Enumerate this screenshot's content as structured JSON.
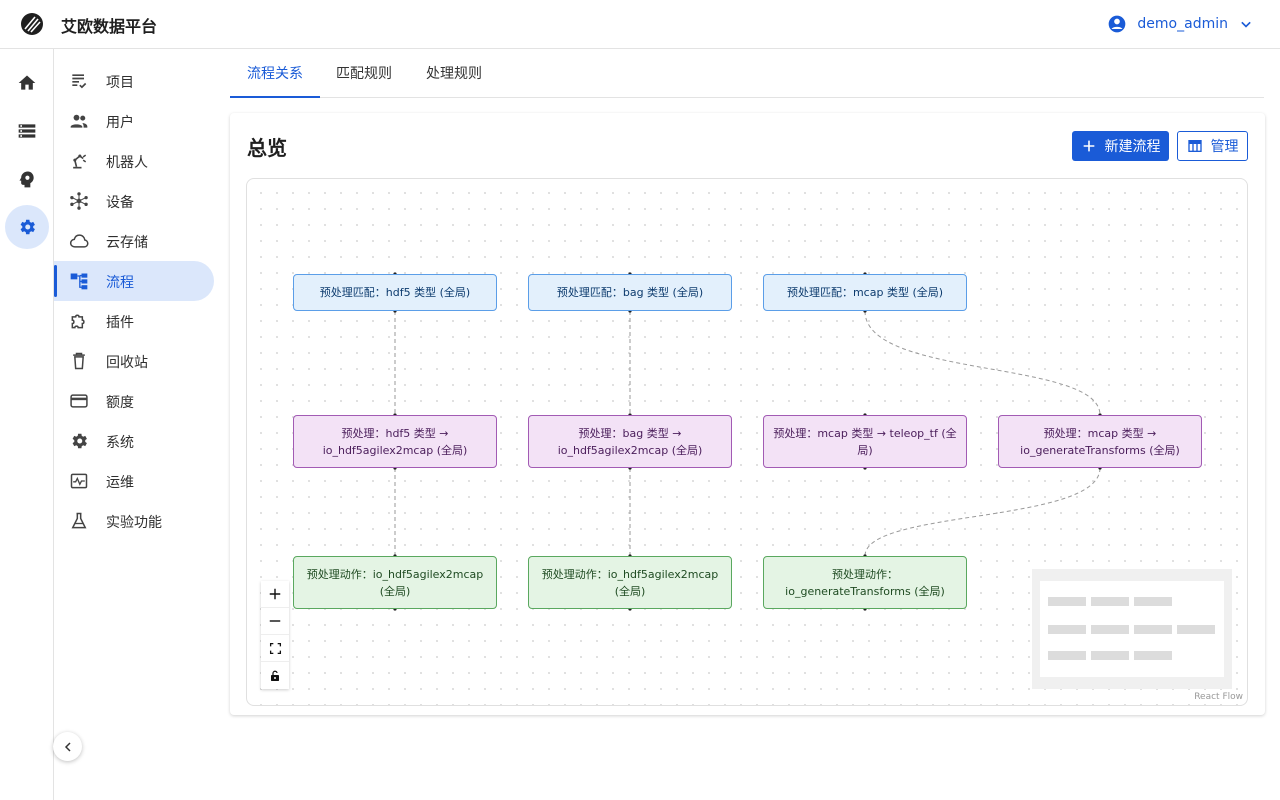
{
  "header": {
    "app_title": "艾欧数据平台",
    "user_name": "demo_admin",
    "icons": [
      "logo-icon",
      "account-circle-icon",
      "chevron-down-icon"
    ]
  },
  "rail": {
    "items": [
      {
        "icon": "home-icon",
        "active": false
      },
      {
        "icon": "storage-icon",
        "active": false
      },
      {
        "icon": "psychology-icon",
        "active": false
      },
      {
        "icon": "gear-icon",
        "active": true
      }
    ],
    "collapse_icon": "chevron-left-icon"
  },
  "subnav": {
    "items": [
      {
        "label": "项目",
        "icon": "checklist-icon"
      },
      {
        "label": "用户",
        "icon": "people-icon"
      },
      {
        "label": "机器人",
        "icon": "robot-arm-icon"
      },
      {
        "label": "设备",
        "icon": "hub-icon"
      },
      {
        "label": "云存储",
        "icon": "cloud-icon"
      },
      {
        "label": "流程",
        "icon": "flow-tree-icon",
        "active": true
      },
      {
        "label": "插件",
        "icon": "puzzle-icon"
      },
      {
        "label": "回收站",
        "icon": "trash-icon"
      },
      {
        "label": "额度",
        "icon": "credit-card-icon"
      },
      {
        "label": "系统",
        "icon": "gear-icon"
      },
      {
        "label": "运维",
        "icon": "monitor-icon"
      },
      {
        "label": "实验功能",
        "icon": "flask-icon"
      }
    ]
  },
  "tabs": [
    {
      "label": "流程关系",
      "active": true
    },
    {
      "label": "匹配规则",
      "active": false
    },
    {
      "label": "处理规则",
      "active": false
    }
  ],
  "card": {
    "title": "总览",
    "new_flow_label": "新建流程",
    "manage_label": "管理"
  },
  "flow": {
    "nodes": {
      "m1": "预处理匹配：hdf5 类型 (全局)",
      "m2": "预处理匹配：bag 类型 (全局)",
      "m3": "预处理匹配：mcap 类型 (全局)",
      "p1": "预处理：hdf5 类型 → io_hdf5agilex2mcap (全局)",
      "p2": "预处理：bag 类型 → io_hdf5agilex2mcap (全局)",
      "p3": "预处理：mcap 类型 → teleop_tf (全局)",
      "p4": "预处理：mcap 类型 → io_generateTransforms (全局)",
      "a1": "预处理动作：io_hdf5agilex2mcap (全局)",
      "a2": "预处理动作：io_hdf5agilex2mcap (全局)",
      "a3": "预处理动作：io_generateTransforms (全局)"
    },
    "attribution": "React Flow",
    "controls": [
      "zoom-in-icon",
      "zoom-out-icon",
      "fit-view-icon",
      "lock-icon"
    ]
  },
  "colors": {
    "accent": "#1a5bd7",
    "match_bg": "#e3f0fc",
    "process_bg": "#f3e2f6",
    "action_bg": "#e4f4e4"
  }
}
